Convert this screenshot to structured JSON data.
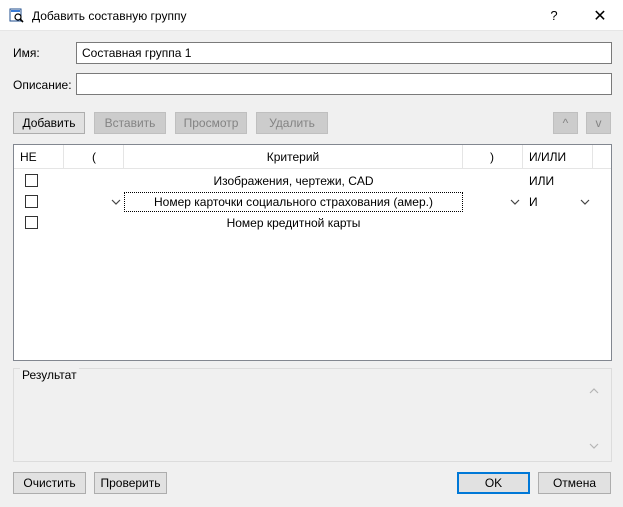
{
  "window": {
    "title": "Добавить составную группу",
    "help": "?",
    "close": "✕"
  },
  "form": {
    "name_label": "Имя:",
    "name_value": "Составная группа 1",
    "desc_label": "Описание:",
    "desc_value": ""
  },
  "toolbar": {
    "add": "Добавить",
    "insert": "Вставить",
    "view": "Просмотр",
    "delete": "Удалить",
    "up": "^",
    "down": "v"
  },
  "grid": {
    "headers": {
      "not": "НЕ",
      "open": "(",
      "criterion": "Критерий",
      "close": ")",
      "andor": "И/ИЛИ"
    },
    "rows": [
      {
        "open": "",
        "criterion": "Изображения, чертежи, CAD",
        "close": "",
        "andor": "ИЛИ"
      },
      {
        "open": "",
        "criterion": "Номер карточки социального страхования (амер.)",
        "close": "",
        "andor": "И"
      },
      {
        "open": "",
        "criterion": "Номер кредитной карты",
        "close": "",
        "andor": ""
      }
    ]
  },
  "result": {
    "label": "Результат"
  },
  "footer": {
    "clear": "Очистить",
    "check": "Проверить",
    "ok": "OK",
    "cancel": "Отмена"
  },
  "colors": {
    "accent": "#0078d7",
    "window_bg": "#f0f0f0"
  }
}
